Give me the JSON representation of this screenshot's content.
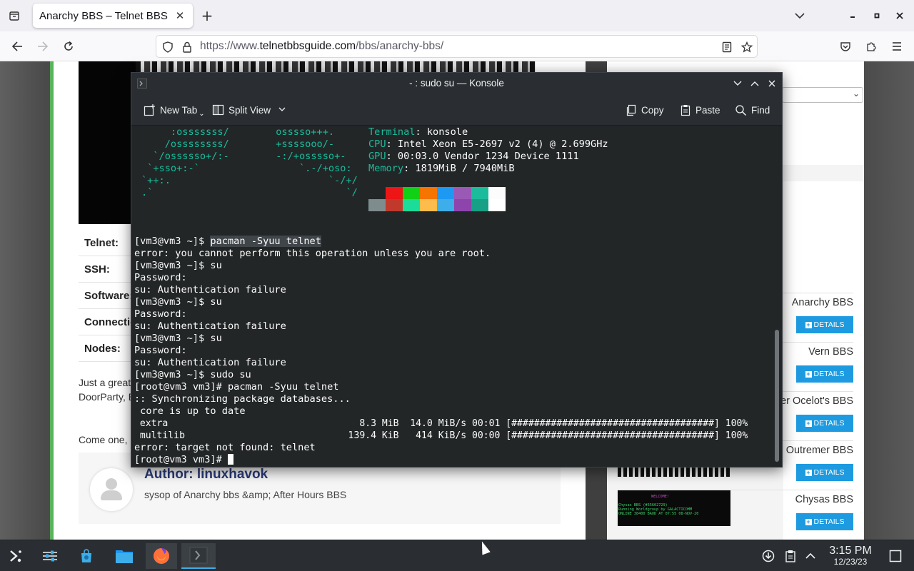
{
  "browser": {
    "tab_title": "Anarchy BBS – Telnet BBS Guide",
    "url_base": "https://www.",
    "url_domain": "telnetbbsguide.com",
    "url_path": "/bbs/anarchy-bbs/"
  },
  "page": {
    "info_labels": [
      "Telnet:",
      "SSH:",
      "Software:",
      "Connections:",
      "Nodes:"
    ],
    "para1_line1": "Just a great",
    "para1_line2": "DoorParty, B",
    "para2": "Come one, c",
    "author_label": "Author: ",
    "author_name": "linuxhavok",
    "author_desc": "sysop of Anarchy bbs &amp; After Hours BBS",
    "bbs_list": [
      {
        "name": "Anarchy BBS",
        "button": "DETAILS"
      },
      {
        "name": "Vern BBS",
        "button": "DETAILS"
      },
      {
        "name": "ver Ocelot's BBS",
        "button": "DETAILS"
      },
      {
        "name": "Outremer BBS",
        "button": "DETAILS"
      },
      {
        "name": "Chysas BBS",
        "button": "DETAILS"
      }
    ],
    "chysas_img_text": [
      "WELCOME!",
      "Chysas BBS (#35602729)",
      "Running Worldgroup by GALACTICOMM",
      "ONLINE 38400 BAUD AT 07:55 08-NOV-20"
    ]
  },
  "konsole": {
    "title": "- : sudo su — Konsole",
    "toolbar": {
      "new_tab": "New Tab",
      "split_view": "Split View",
      "copy": "Copy",
      "paste": "Paste",
      "find": "Find"
    },
    "neofetch_art": [
      "     :osssssss/        osssso+++.",
      "    /ossssssss/        +ssssooo/-",
      "  `/ossssso+/:-        -:/+osssso+-",
      " `+sso+:-`                 `.-/+oso:",
      "`++:.                           `-/+/",
      ".`                                 `/"
    ],
    "sysinfo": [
      {
        "key": "Terminal",
        "value": ": konsole"
      },
      {
        "key": "CPU",
        "value": ": Intel Xeon E5-2697 v2 (4) @ 2.699GHz"
      },
      {
        "key": "GPU",
        "value": ": 00:03.0 Vendor 1234 Device 1111"
      },
      {
        "key": "Memory",
        "value": ": 1819MiB / 7940MiB"
      }
    ],
    "palette_top": [
      "#232627",
      "#ed1515",
      "#11d116",
      "#f67400",
      "#1d99f3",
      "#9b59b6",
      "#1abc9c",
      "#fcfcfc"
    ],
    "palette_bottom": [
      "#7f8c8d",
      "#c0392b",
      "#1cdc9a",
      "#fdbc4b",
      "#3daee9",
      "#8e44ad",
      "#16a085",
      "#ffffff"
    ],
    "lines": {
      "l1_prompt": "[vm3@vm3 ~]$ ",
      "l1_cmd": "pacman -Syuu telnet",
      "l2": "error: you cannot perform this operation unless you are root.",
      "l3": "[vm3@vm3 ~]$ su",
      "l4": "Password:",
      "l5": "su: Authentication failure",
      "l6": "[vm3@vm3 ~]$ su",
      "l7": "Password:",
      "l8": "su: Authentication failure",
      "l9": "[vm3@vm3 ~]$ su",
      "l10": "Password:",
      "l11": "su: Authentication failure",
      "l12": "[vm3@vm3 ~]$ sudo su",
      "l13": "[root@vm3 vm3]# pacman -Syuu telnet",
      "l14": ":: Synchronizing package databases...",
      "l15": " core is up to date",
      "l16": " extra                                  8.3 MiB  14.0 MiB/s 00:01 [####################################] 100%",
      "l17": " multilib                             139.4 KiB   414 KiB/s 00:00 [####################################] 100%",
      "l18": "error: target not found: telnet",
      "l19_prompt": "[root@vm3 vm3]# "
    }
  },
  "taskbar": {
    "time": "3:15 PM",
    "date": "12/23/23"
  }
}
